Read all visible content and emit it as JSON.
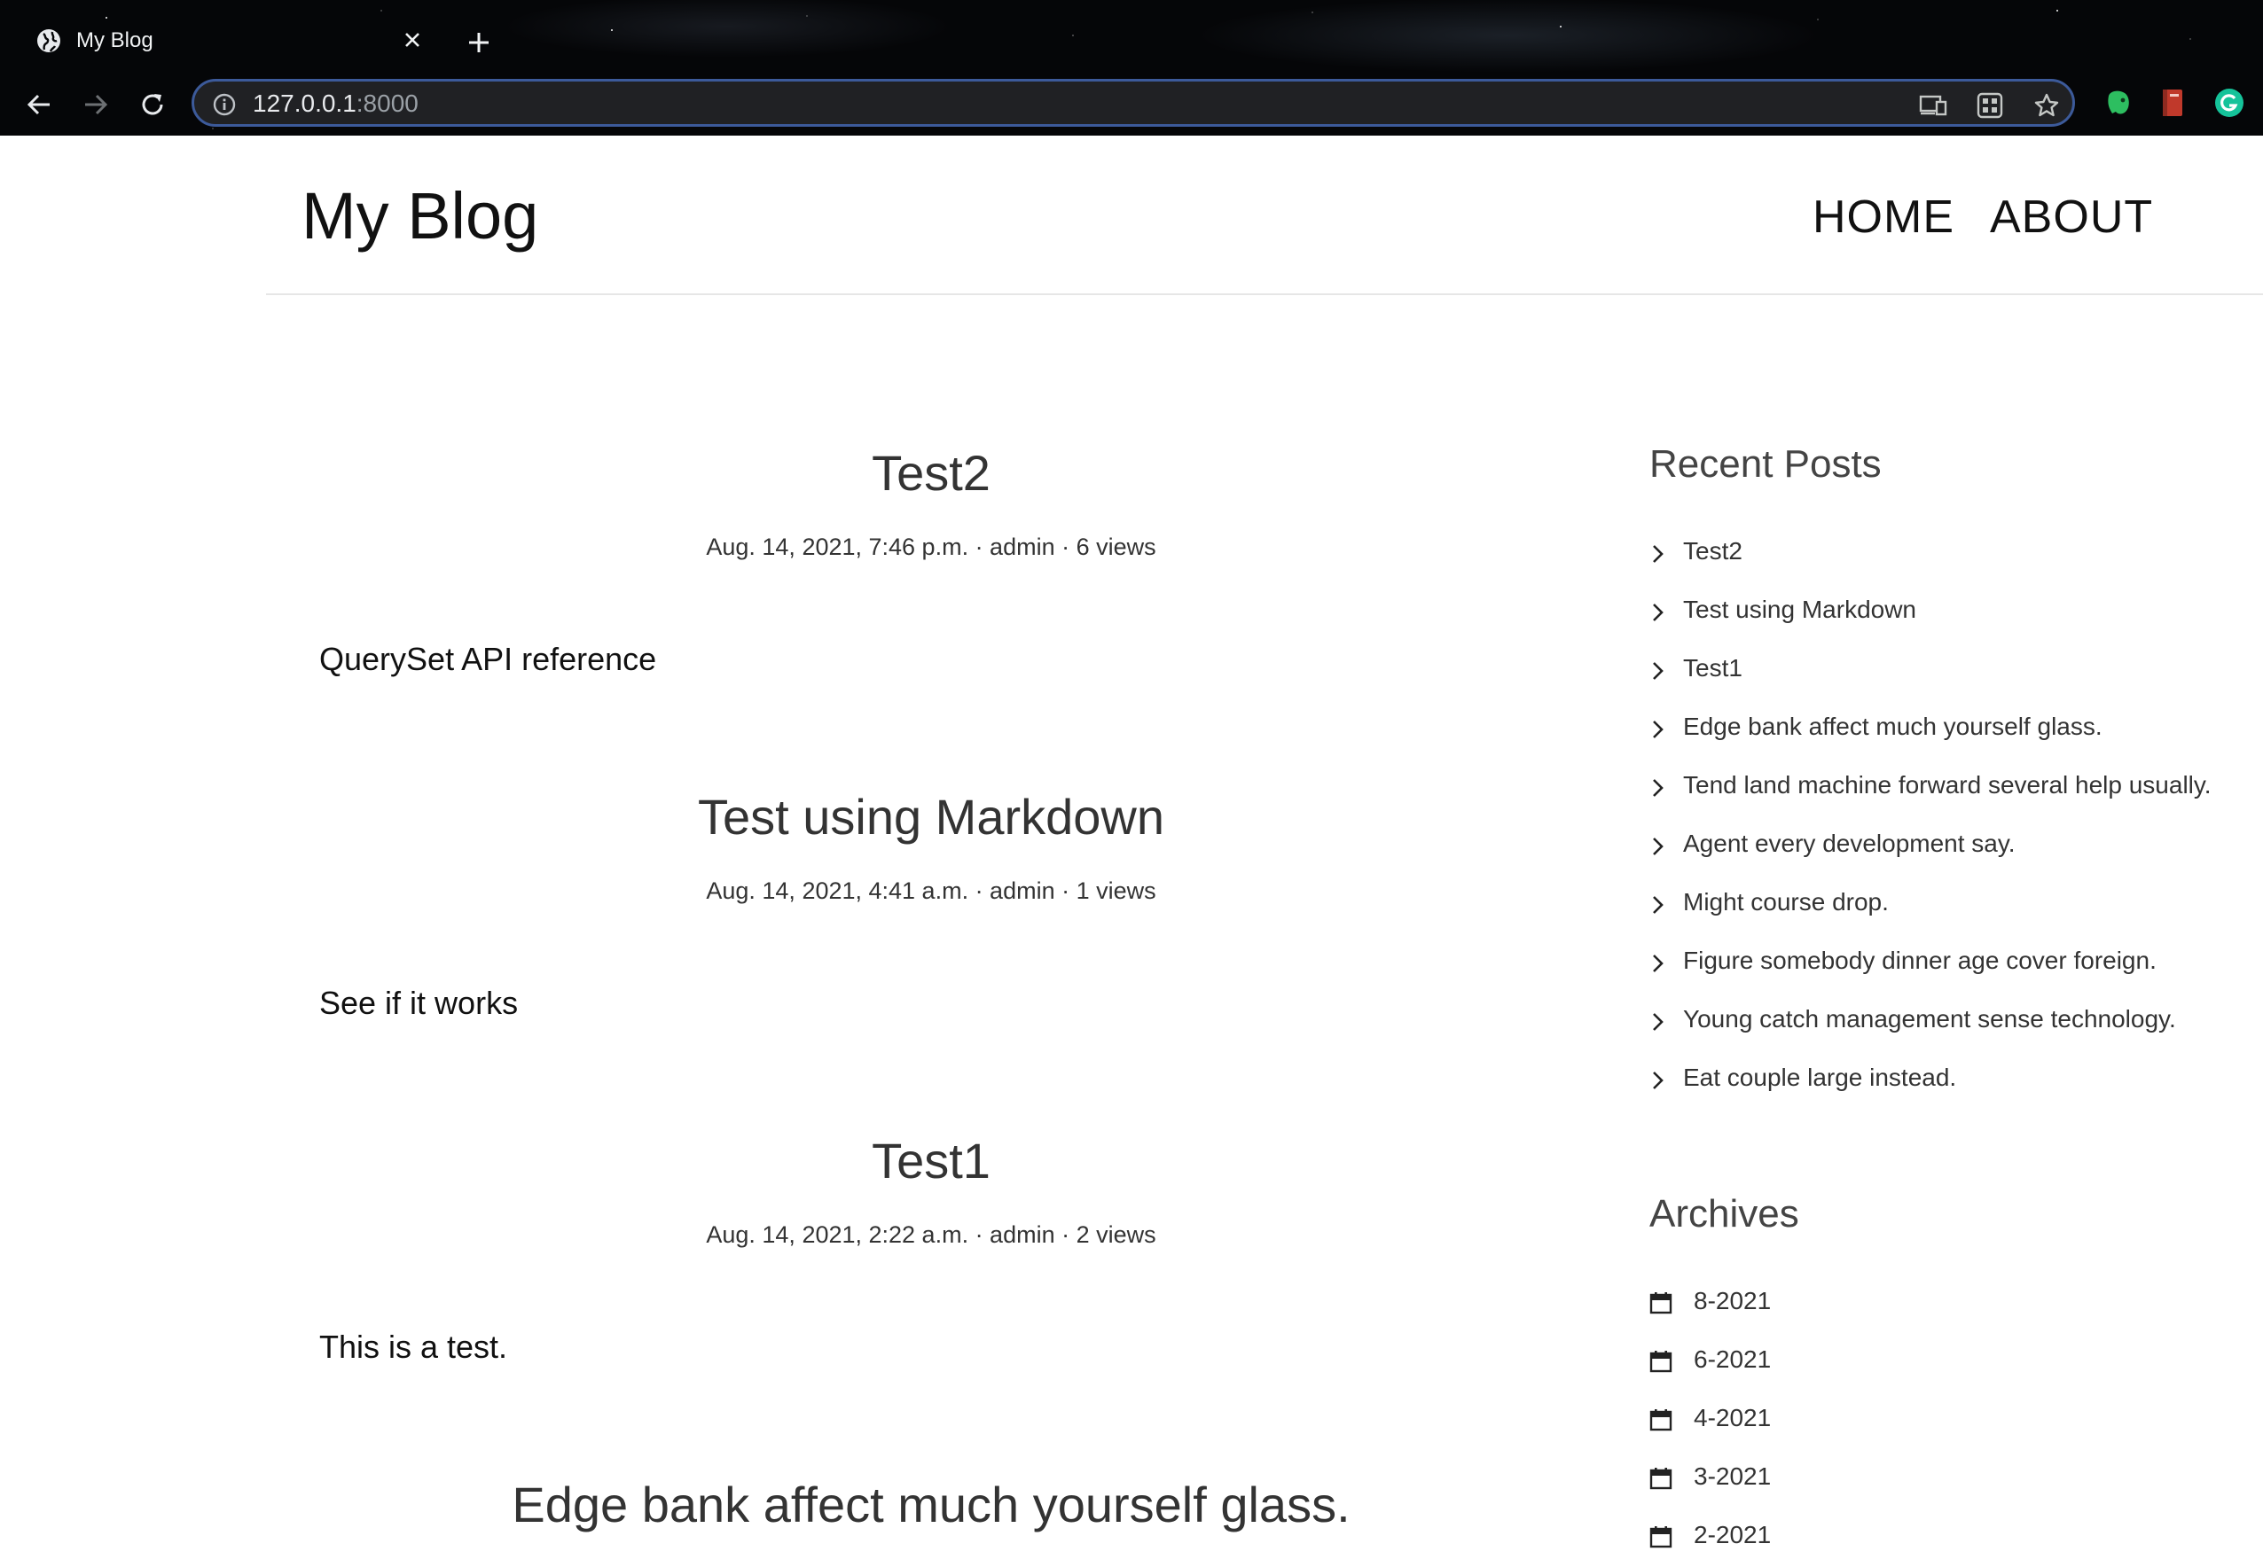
{
  "browser": {
    "tab_title": "My Blog",
    "url_host": "127.0.0.1",
    "url_port": ":8000"
  },
  "site": {
    "title": "My Blog",
    "nav": [
      "HOME",
      "ABOUT"
    ]
  },
  "posts": [
    {
      "title": "Test2",
      "meta": "Aug. 14, 2021, 7:46 p.m. · admin · 6 views",
      "excerpt": "QuerySet API reference"
    },
    {
      "title": "Test using Markdown",
      "meta": "Aug. 14, 2021, 4:41 a.m. · admin · 1 views",
      "excerpt": "See if it works"
    },
    {
      "title": "Test1",
      "meta": "Aug. 14, 2021, 2:22 a.m. · admin · 2 views",
      "excerpt": "This is a test."
    },
    {
      "title": "Edge bank affect much yourself glass."
    }
  ],
  "sidebar": {
    "recent_title": "Recent Posts",
    "recent": [
      "Test2",
      "Test using Markdown",
      "Test1",
      "Edge bank affect much yourself glass.",
      "Tend land machine forward several help usually.",
      "Agent every development say.",
      "Might course drop.",
      "Figure somebody dinner age cover foreign.",
      "Young catch management sense technology.",
      "Eat couple large instead."
    ],
    "archives_title": "Archives",
    "archives": [
      "8-2021",
      "6-2021",
      "4-2021",
      "3-2021",
      "2-2021"
    ]
  }
}
